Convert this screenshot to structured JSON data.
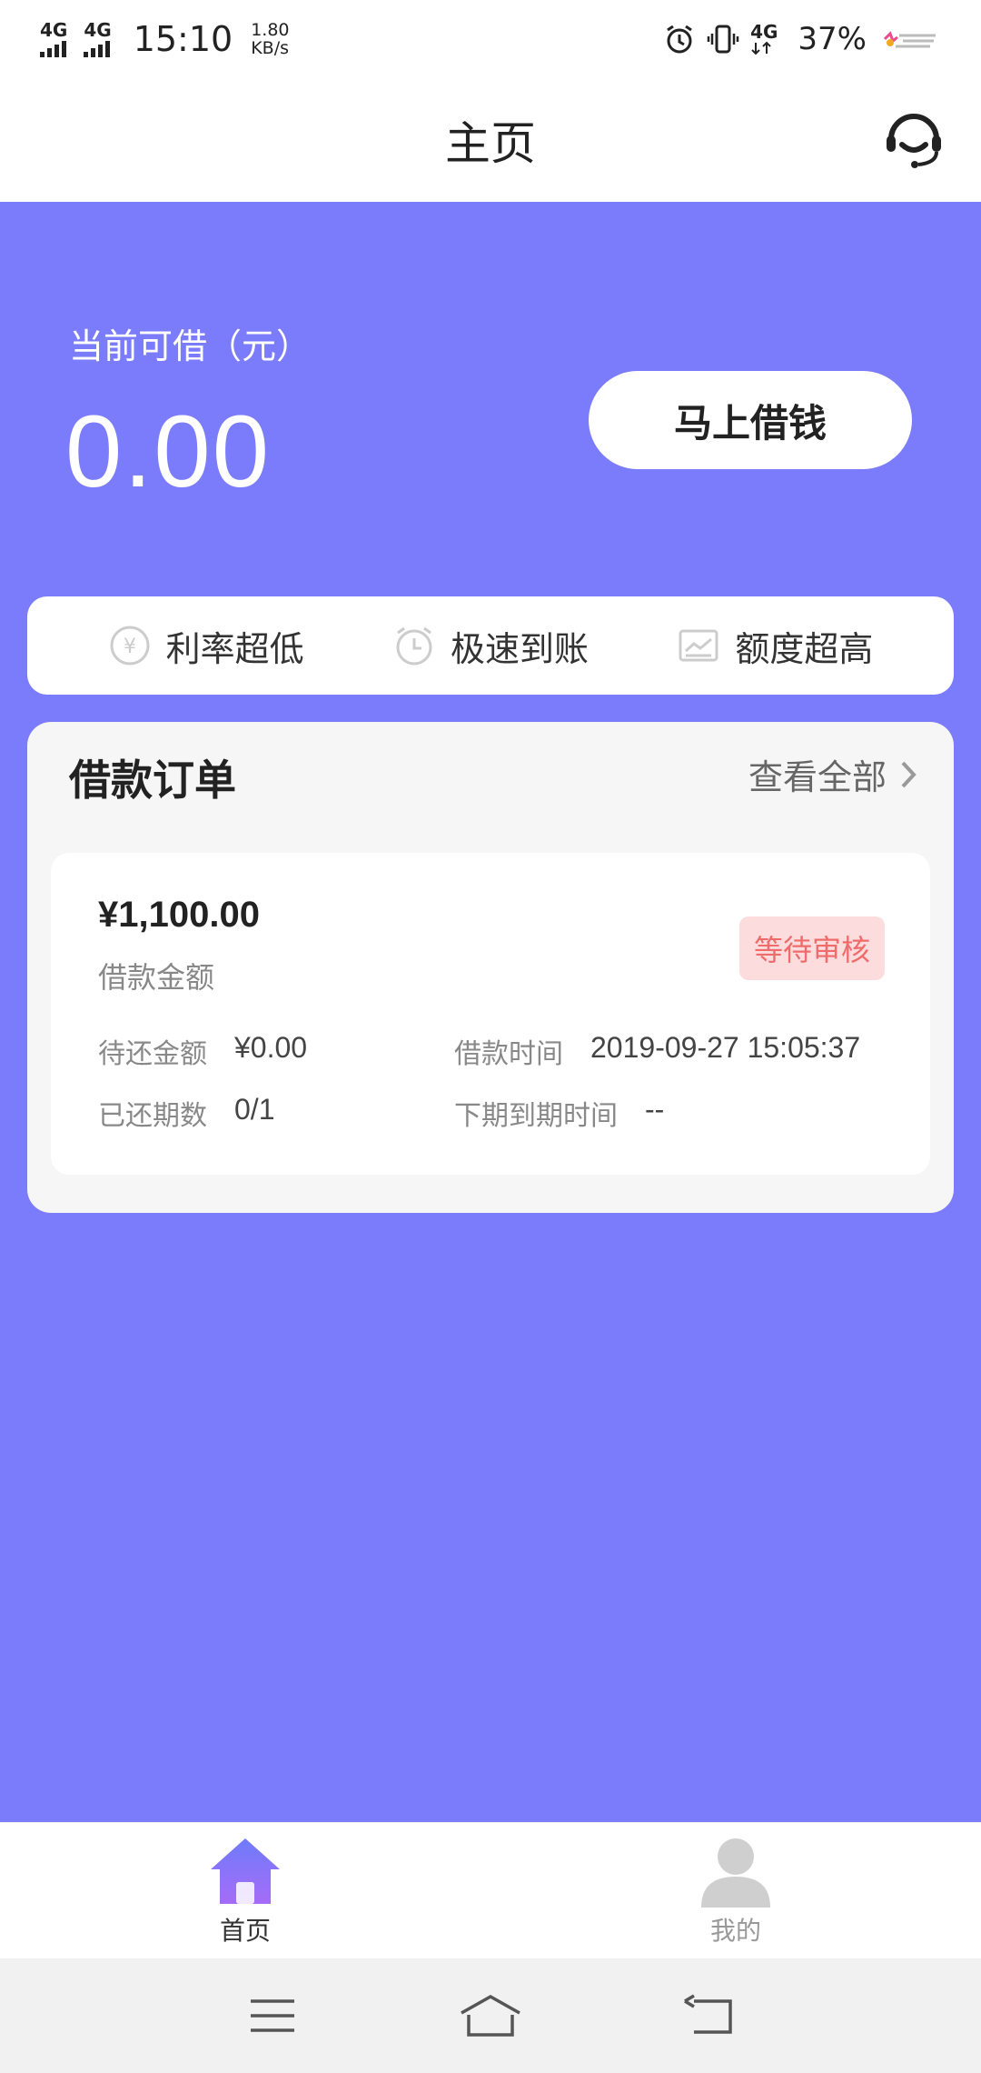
{
  "status_bar": {
    "network1": "4G",
    "network2": "4G",
    "time": "15:10",
    "speed_value": "1.80",
    "speed_unit": "KB/s",
    "network3": "4G",
    "battery": "37%"
  },
  "nav": {
    "title": "主页",
    "service_icon": "customer-service-headset-icon"
  },
  "hero": {
    "available_label": "当前可借（元）",
    "available_amount": "0.00",
    "borrow_button": "马上借钱"
  },
  "features": [
    {
      "icon": "yen-coin-icon",
      "label": "利率超低"
    },
    {
      "icon": "alarm-clock-icon",
      "label": "极速到账"
    },
    {
      "icon": "chart-icon",
      "label": "额度超高"
    }
  ],
  "orders": {
    "title": "借款订单",
    "view_all": "查看全部",
    "items": [
      {
        "amount": "¥1,100.00",
        "amount_label": "借款金额",
        "status": "等待审核",
        "due_label": "待还金额",
        "due_value": "¥0.00",
        "time_label": "借款时间",
        "time_value": "2019-09-27 15:05:37",
        "paid_label": "已还期数",
        "paid_value": "0/1",
        "next_due_label": "下期到期时间",
        "next_due_value": "--"
      }
    ]
  },
  "tabs": [
    {
      "label": "首页",
      "icon": "home-icon",
      "active": true
    },
    {
      "label": "我的",
      "icon": "person-icon",
      "active": false
    }
  ],
  "colors": {
    "primary": "#7b7cfb",
    "badge_bg": "#fcdcdc",
    "badge_text": "#f06b6b"
  }
}
